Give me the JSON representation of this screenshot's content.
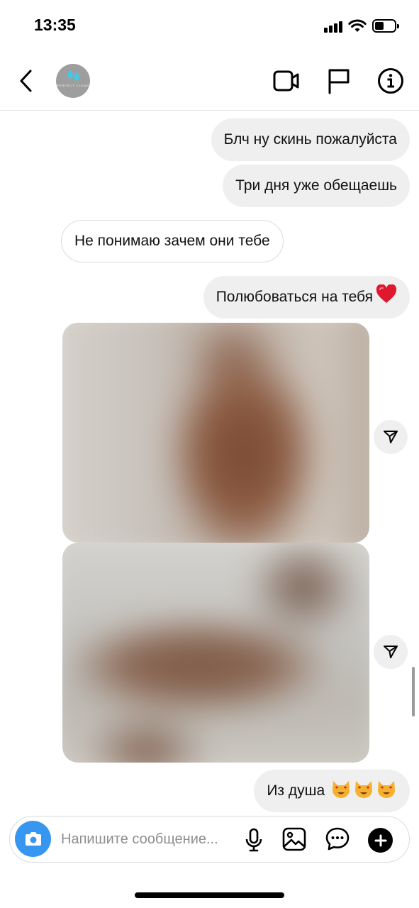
{
  "status_bar": {
    "time": "13:35",
    "battery_level": 0.45
  },
  "header": {
    "avatar_logo_text": "PERFECT CLEAN",
    "icons": [
      "back-icon",
      "video-call-icon",
      "flag-icon",
      "info-icon"
    ]
  },
  "messages": [
    {
      "side": "sent",
      "text": "Блч ну скинь пожалуйста"
    },
    {
      "side": "sent",
      "text": "Три дня уже обещаешь"
    },
    {
      "side": "received",
      "text": "Не понимаю зачем они тебе"
    },
    {
      "side": "sent",
      "text": "Полюбоваться на тебя",
      "emoji": "❤️"
    },
    {
      "side": "sent",
      "type": "photo",
      "blurred": true
    },
    {
      "side": "sent",
      "type": "photo",
      "blurred": true
    },
    {
      "side": "sent",
      "text": "Из душа",
      "emoji": "😻😻😻"
    }
  ],
  "composer": {
    "placeholder": "Напишите сообщение..."
  },
  "colors": {
    "sent_bubble": "#efefef",
    "received_border": "#dbdbdb",
    "camera_button": "#3797f0"
  }
}
